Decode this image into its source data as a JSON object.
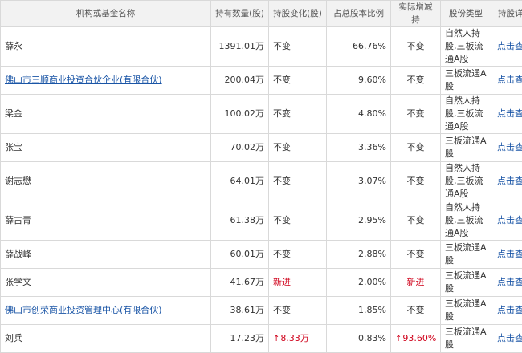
{
  "table": {
    "headers": {
      "name": "机构或基金名称",
      "amount": "持有数量(股)",
      "change": "持股变化(股)",
      "ratio": "占总股本比例",
      "actual": "实际增减持",
      "type": "股份类型",
      "detail": "持股详情"
    },
    "rows": [
      {
        "name": "薛永",
        "link": false,
        "amount": "1391.01万",
        "change": "不变",
        "change_style": "plain",
        "ratio": "66.76%",
        "actual": "不变",
        "actual_style": "plain",
        "type": "自然人持股,三板流通A股",
        "detail": "点击查看"
      },
      {
        "name": "佛山市三顺商业投资合伙企业(有限合伙)",
        "link": true,
        "amount": "200.04万",
        "change": "不变",
        "change_style": "plain",
        "ratio": "9.60%",
        "actual": "不变",
        "actual_style": "plain",
        "type": "三板流通A股",
        "detail": "点击查看"
      },
      {
        "name": "梁金",
        "link": false,
        "amount": "100.02万",
        "change": "不变",
        "change_style": "plain",
        "ratio": "4.80%",
        "actual": "不变",
        "actual_style": "plain",
        "type": "自然人持股,三板流通A股",
        "detail": "点击查看"
      },
      {
        "name": "张宝",
        "link": false,
        "amount": "70.02万",
        "change": "不变",
        "change_style": "plain",
        "ratio": "3.36%",
        "actual": "不变",
        "actual_style": "plain",
        "type": "三板流通A股",
        "detail": "点击查看"
      },
      {
        "name": "谢志懋",
        "link": false,
        "amount": "64.01万",
        "change": "不变",
        "change_style": "plain",
        "ratio": "3.07%",
        "actual": "不变",
        "actual_style": "plain",
        "type": "自然人持股,三板流通A股",
        "detail": "点击查看"
      },
      {
        "name": "薛古青",
        "link": false,
        "amount": "61.38万",
        "change": "不变",
        "change_style": "plain",
        "ratio": "2.95%",
        "actual": "不变",
        "actual_style": "plain",
        "type": "自然人持股,三板流通A股",
        "detail": "点击查看"
      },
      {
        "name": "薛战峰",
        "link": false,
        "amount": "60.01万",
        "change": "不变",
        "change_style": "plain",
        "ratio": "2.88%",
        "actual": "不变",
        "actual_style": "plain",
        "type": "三板流通A股",
        "detail": "点击查看"
      },
      {
        "name": "张学文",
        "link": false,
        "amount": "41.67万",
        "change": "新进",
        "change_style": "new",
        "ratio": "2.00%",
        "actual": "新进",
        "actual_style": "new",
        "type": "三板流通A股",
        "detail": "点击查看"
      },
      {
        "name": "佛山市创荣商业投资管理中心(有限合伙)",
        "link": true,
        "amount": "38.61万",
        "change": "不变",
        "change_style": "plain",
        "ratio": "1.85%",
        "actual": "不变",
        "actual_style": "plain",
        "type": "三板流通A股",
        "detail": "点击查看"
      },
      {
        "name": "刘兵",
        "link": false,
        "amount": "17.23万",
        "change": "8.33万",
        "change_style": "up",
        "ratio": "0.83%",
        "actual": "93.60%",
        "actual_style": "up",
        "type": "三板流通A股",
        "detail": "点击查看"
      }
    ]
  },
  "colors": {
    "header_bg": "#f2f2f2",
    "border": "#d9d9d9",
    "link": "#1a55a6",
    "increase": "#d0021b"
  },
  "icons": {
    "increase": "arrow-up-icon"
  }
}
